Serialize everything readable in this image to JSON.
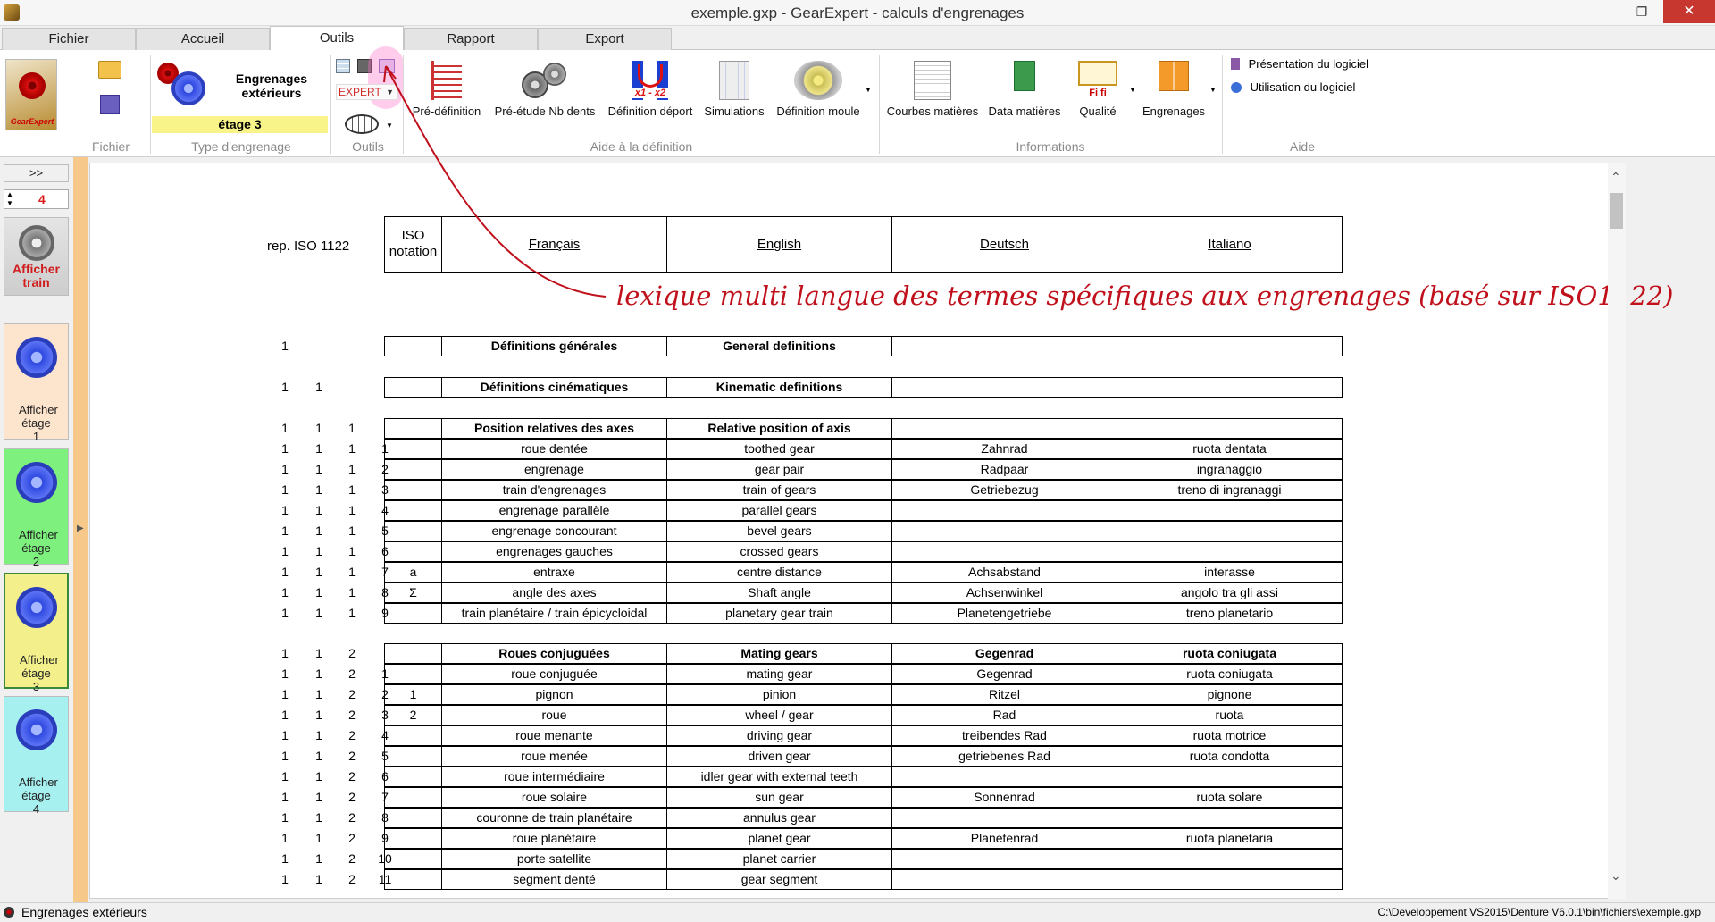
{
  "window": {
    "title": "exemple.gxp - GearExpert - calculs d'engrenages"
  },
  "tabs": [
    "Fichier",
    "Accueil",
    "Outils",
    "Rapport",
    "Export"
  ],
  "active_tab": "Outils",
  "ribbon": {
    "gear_type_title": "Engrenages extérieurs",
    "stage": "étage 3",
    "expert_mode": "EXPERT",
    "logo_text": "GearExpert",
    "buttons": {
      "predef": "Pré-définition",
      "preetude": "Pré-étude Nb dents",
      "deport": "Définition déport",
      "simulations": "Simulations",
      "moule": "Définition moule",
      "courbes": "Courbes matières",
      "data": "Data matières",
      "qualite": "Qualité",
      "engrenages": "Engrenages",
      "presentation": "Présentation du logiciel",
      "utilisation": "Utilisation du logiciel",
      "deport_icon": "x1 - x2",
      "qualite_icon": "Fi fi"
    },
    "groups": [
      "Fichier",
      "Type d'engrenage",
      "Outils",
      "Aide à la définition",
      "Informations",
      "Aide"
    ]
  },
  "sidebar": {
    "expand_label": ">>",
    "stage_count": "4",
    "show_train": "Afficher train",
    "stages": [
      "Afficher étage 1",
      "Afficher étage 2",
      "Afficher étage 3",
      "Afficher étage 4"
    ],
    "stage_colors": [
      "#fde4cc",
      "#7ef07e",
      "#f3f08c",
      "#a6f0f0"
    ]
  },
  "document": {
    "ref_label": "rep. ISO 1122",
    "header": {
      "iso": "ISO notation",
      "fr": "Français",
      "en": "English",
      "de": "Deutsch",
      "it": "Italiano"
    },
    "annotation": "lexique multi langue des termes spécifiques aux engrenages    (basé sur ISO1122)",
    "rows": [
      {
        "nums": [
          "1",
          "",
          "",
          ""
        ],
        "iso": "",
        "fr": "Définitions générales",
        "en": "General definitions",
        "de": "",
        "it": "",
        "bold": true
      },
      {
        "nums": [
          "1",
          "1",
          "",
          ""
        ],
        "iso": "",
        "fr": "Définitions cinématiques",
        "en": "Kinematic definitions",
        "de": "",
        "it": "",
        "bold": true
      },
      {
        "nums": [
          "1",
          "1",
          "1",
          ""
        ],
        "iso": "",
        "fr": "Position relatives des axes",
        "en": "Relative position of axis",
        "de": "",
        "it": "",
        "bold": true
      },
      {
        "nums": [
          "1",
          "1",
          "1",
          "1"
        ],
        "iso": "",
        "fr": "roue dentée",
        "en": "toothed gear",
        "de": "Zahnrad",
        "it": "ruota dentata"
      },
      {
        "nums": [
          "1",
          "1",
          "1",
          "2"
        ],
        "iso": "",
        "fr": "engrenage",
        "en": "gear pair",
        "de": "Radpaar",
        "it": "ingranaggio"
      },
      {
        "nums": [
          "1",
          "1",
          "1",
          "3"
        ],
        "iso": "",
        "fr": "train d'engrenages",
        "en": "train of gears",
        "de": "Getriebezug",
        "it": "treno di ingranaggi"
      },
      {
        "nums": [
          "1",
          "1",
          "1",
          "4"
        ],
        "iso": "",
        "fr": "engrenage parallèle",
        "en": "parallel gears",
        "de": "",
        "it": ""
      },
      {
        "nums": [
          "1",
          "1",
          "1",
          "5"
        ],
        "iso": "",
        "fr": "engrenage concourant",
        "en": "bevel gears",
        "de": "",
        "it": ""
      },
      {
        "nums": [
          "1",
          "1",
          "1",
          "6"
        ],
        "iso": "",
        "fr": "engrenages gauches",
        "en": "crossed gears",
        "de": "",
        "it": ""
      },
      {
        "nums": [
          "1",
          "1",
          "1",
          "7"
        ],
        "iso": "a",
        "fr": "entraxe",
        "en": "centre distance",
        "de": "Achsabstand",
        "it": "interasse"
      },
      {
        "nums": [
          "1",
          "1",
          "1",
          "8"
        ],
        "iso": "Σ",
        "fr": "angle des axes",
        "en": "Shaft angle",
        "de": "Achsenwinkel",
        "it": "angolo tra gli assi"
      },
      {
        "nums": [
          "1",
          "1",
          "1",
          "9"
        ],
        "iso": "",
        "fr": "train planétaire / train épicycloidal",
        "en": "planetary gear train",
        "de": "Planetengetriebe",
        "it": "treno planetario"
      },
      {
        "nums": [
          "1",
          "1",
          "2",
          ""
        ],
        "iso": "",
        "fr": "Roues conjuguées",
        "en": "Mating gears",
        "de": "Gegenrad",
        "it": "ruota coniugata",
        "bold": true
      },
      {
        "nums": [
          "1",
          "1",
          "2",
          "1"
        ],
        "iso": "",
        "fr": "roue conjuguée",
        "en": "mating gear",
        "de": "Gegenrad",
        "it": "ruota coniugata"
      },
      {
        "nums": [
          "1",
          "1",
          "2",
          "2"
        ],
        "iso": "1",
        "fr": "pignon",
        "en": "pinion",
        "de": "Ritzel",
        "it": "pignone"
      },
      {
        "nums": [
          "1",
          "1",
          "2",
          "3"
        ],
        "iso": "2",
        "fr": "roue",
        "en": "wheel / gear",
        "de": "Rad",
        "it": "ruota"
      },
      {
        "nums": [
          "1",
          "1",
          "2",
          "4"
        ],
        "iso": "",
        "fr": "roue menante",
        "en": "driving gear",
        "de": "treibendes Rad",
        "it": "ruota motrice"
      },
      {
        "nums": [
          "1",
          "1",
          "2",
          "5"
        ],
        "iso": "",
        "fr": "roue menée",
        "en": "driven gear",
        "de": "getriebenes Rad",
        "it": "ruota condotta"
      },
      {
        "nums": [
          "1",
          "1",
          "2",
          "6"
        ],
        "iso": "",
        "fr": "roue intermédiaire",
        "en": "idler gear with external teeth",
        "de": "",
        "it": ""
      },
      {
        "nums": [
          "1",
          "1",
          "2",
          "7"
        ],
        "iso": "",
        "fr": "roue solaire",
        "en": "sun gear",
        "de": "Sonnenrad",
        "it": "ruota solare"
      },
      {
        "nums": [
          "1",
          "1",
          "2",
          "8"
        ],
        "iso": "",
        "fr": "couronne de train planétaire",
        "en": "annulus gear",
        "de": "",
        "it": ""
      },
      {
        "nums": [
          "1",
          "1",
          "2",
          "9"
        ],
        "iso": "",
        "fr": "roue planétaire",
        "en": "planet gear",
        "de": "Planetenrad",
        "it": "ruota planetaria"
      },
      {
        "nums": [
          "1",
          "1",
          "2",
          "10"
        ],
        "iso": "",
        "fr": "porte satellite",
        "en": "planet carrier",
        "de": "",
        "it": ""
      },
      {
        "nums": [
          "1",
          "1",
          "2",
          "11"
        ],
        "iso": "",
        "fr": "segment denté",
        "en": "gear segment",
        "de": "",
        "it": ""
      }
    ]
  },
  "status": {
    "left": "Engrenages extérieurs",
    "right": "C:\\Developpement VS2015\\Denture V6.0.1\\bin\\fichiers\\exemple.gxp"
  },
  "colors": {
    "annotation": "#c0101b",
    "accent_orange": "#f6c98a",
    "stage_yellow": "#f8f48a"
  }
}
